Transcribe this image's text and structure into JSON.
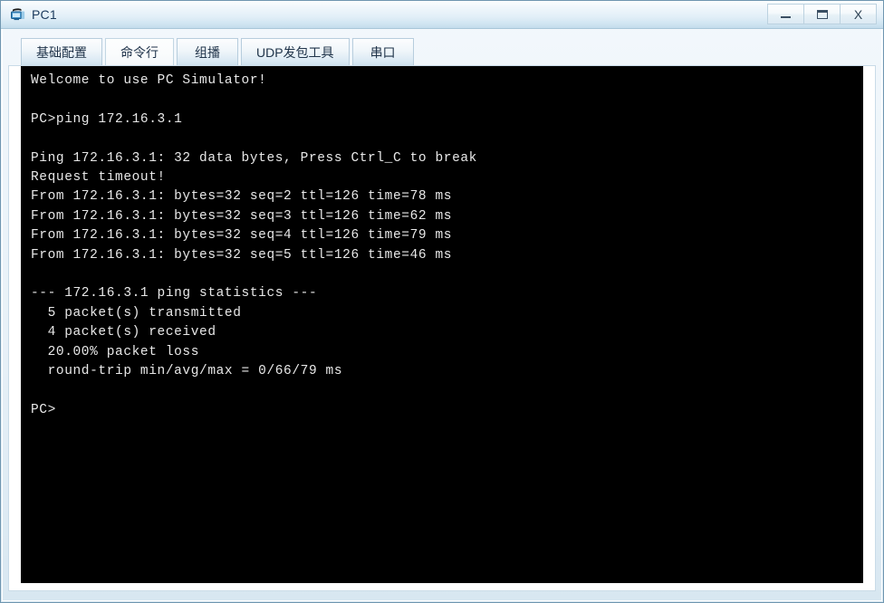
{
  "window": {
    "title": "PC1",
    "icon": "pc-monitor-icon",
    "controls": [
      {
        "name": "minimize",
        "glyph": "—"
      },
      {
        "name": "maximize",
        "glyph": "□"
      },
      {
        "name": "close",
        "glyph": "X"
      }
    ]
  },
  "colors": {
    "titlebar_top": "#fbfdfe",
    "titlebar_bottom": "#c3dcec",
    "window_border": "#6f96b0",
    "terminal_bg": "#000000",
    "terminal_fg": "#e8e8e8",
    "tab_active_bg": "#fdfefe",
    "tab_inactive_bg": "#dfecf5"
  },
  "tabs": [
    {
      "label": "基础配置",
      "active": false
    },
    {
      "label": "命令行",
      "active": true
    },
    {
      "label": "组播",
      "active": false
    },
    {
      "label": "UDP发包工具",
      "active": false
    },
    {
      "label": "串口",
      "active": false
    }
  ],
  "terminal": {
    "lines": [
      "Welcome to use PC Simulator!",
      "",
      "PC>ping 172.16.3.1",
      "",
      "Ping 172.16.3.1: 32 data bytes, Press Ctrl_C to break",
      "Request timeout!",
      "From 172.16.3.1: bytes=32 seq=2 ttl=126 time=78 ms",
      "From 172.16.3.1: bytes=32 seq=3 ttl=126 time=62 ms",
      "From 172.16.3.1: bytes=32 seq=4 ttl=126 time=79 ms",
      "From 172.16.3.1: bytes=32 seq=5 ttl=126 time=46 ms",
      "",
      "--- 172.16.3.1 ping statistics ---",
      "  5 packet(s) transmitted",
      "  4 packet(s) received",
      "  20.00% packet loss",
      "  round-trip min/avg/max = 0/66/79 ms",
      "",
      "PC>"
    ]
  }
}
